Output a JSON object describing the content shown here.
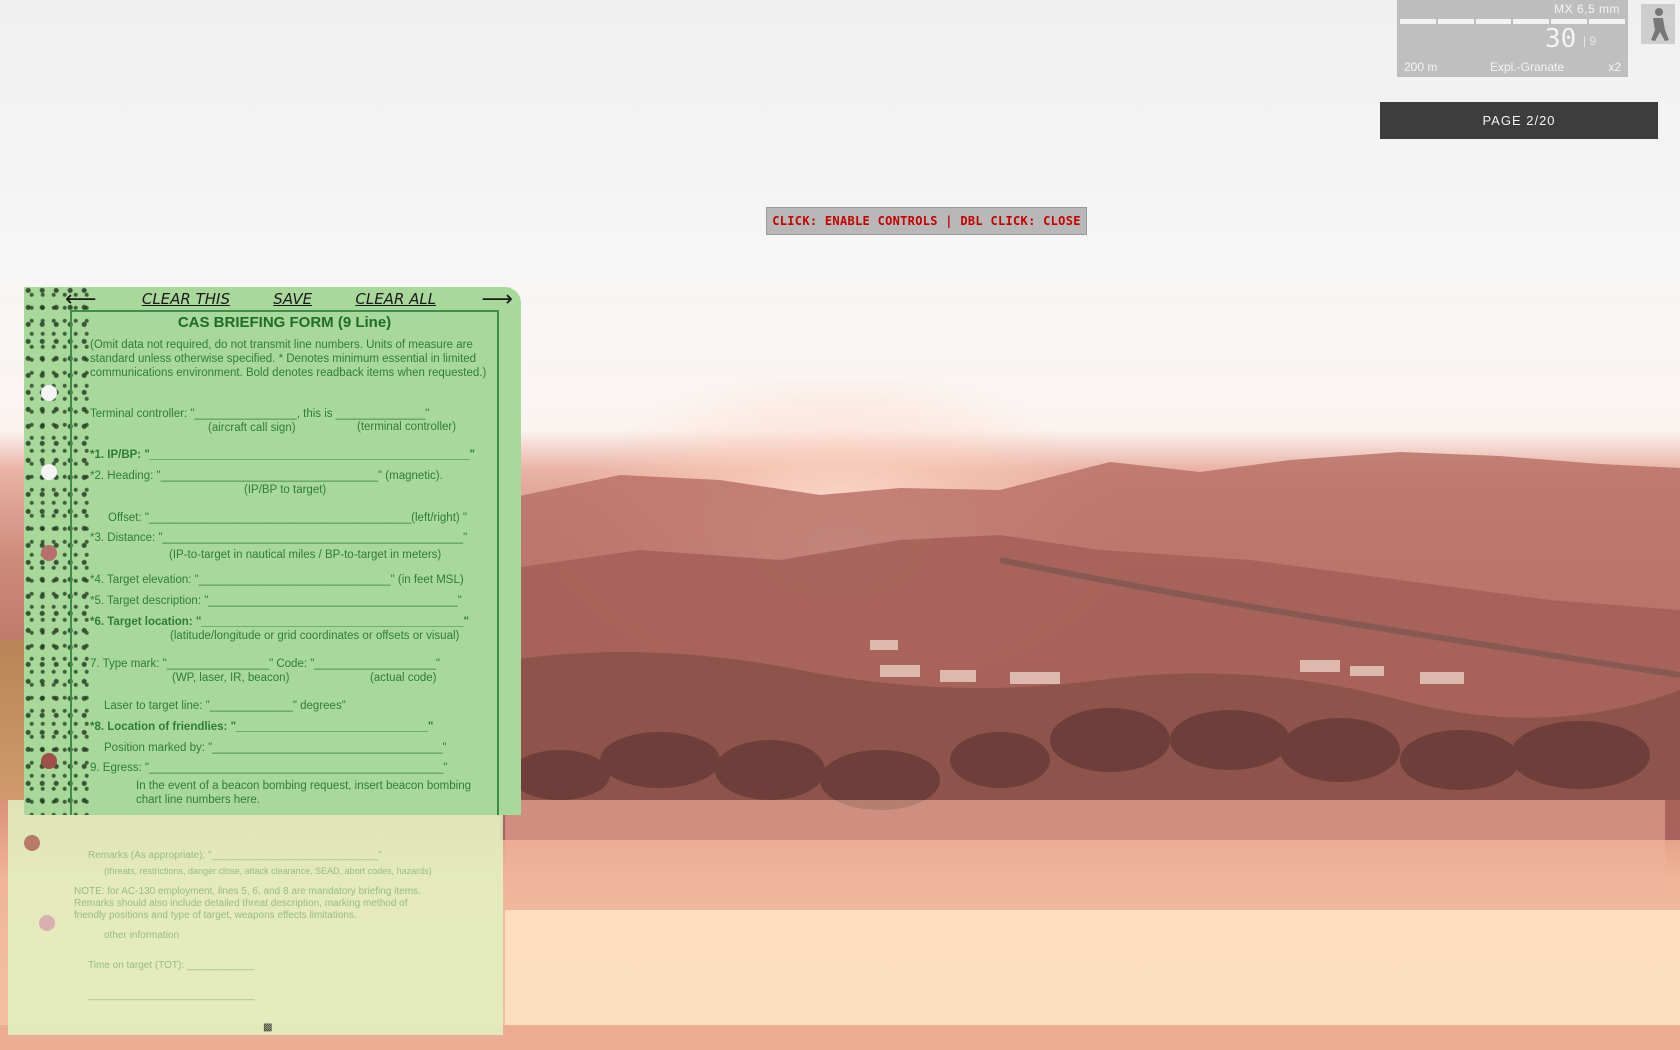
{
  "hud": {
    "weapon_name": "MX 6,5 mm",
    "ammo_count": "30",
    "magazines": "| 9",
    "zeroing": "200 m",
    "ammo_type": "Expl.-Granate",
    "multiplier": "x2"
  },
  "page_indicator": "PAGE 2/20",
  "hint": "CLICK: ENABLE CONTROLS | DBL CLICK: CLOSE",
  "form": {
    "toolbar": {
      "prev_arrow": "⟵",
      "clear_this": "CLEAR THIS",
      "save": "SAVE",
      "clear_all": "CLEAR ALL",
      "next_arrow": "⟶"
    },
    "title": "CAS BRIEFING FORM (9 Line)",
    "intro": "(Omit data not required, do not transmit line numbers. Units of measure are standard unless otherwise specified.  * Denotes minimum essential in limited communications environment.  Bold denotes readback items when requested.)",
    "terminal_controller": "Terminal controller: \"________________, this is ______________\"",
    "aircraft_call_sign": "(aircraft call sign)",
    "terminal_controller_sub": "(terminal controller)",
    "line1": "*1.   IP/BP: \"__________________________________________________\"",
    "line2": "*2.   Heading: \"__________________________________\" (magnetic).",
    "line2_sub": "(IP/BP to target)",
    "offset": "Offset: \"_________________________________________(left/right)  \"",
    "line3": "*3.  Distance: \"_______________________________________________\"",
    "line3_sub": "(IP-to-target in nautical miles / BP-to-target in meters)",
    "line4": "*4.  Target elevation: \"______________________________\" (in feet MSL)",
    "line5": "*5.  Target description: \"_______________________________________\"",
    "line6": "*6.  Target location: \"_________________________________________\"",
    "line6_sub": "(latitude/longitude or grid coordinates or offsets or visual)",
    "line7": "7.  Type mark: \"________________\" Code: \"___________________\"",
    "line7_sub_a": "(WP, laser, IR, beacon)",
    "line7_sub_b": "(actual code)",
    "laser": "Laser to target line: \"_____________\" degrees\"",
    "line8": "*8. Location of friendlies: \"______________________________\"",
    "position_marked": "Position marked by: \"____________________________________\"",
    "line9": "9.  Egress: \"______________________________________________\"",
    "beacon_note": "In the event of a beacon bombing request, insert beacon bombing",
    "beacon_note_2": "chart line numbers here.",
    "remarks": "Remarks (As appropriate): \"______________________________\"",
    "remarks_sub": "(threats, restrictions, danger close, attack clearance, SEAD, abort codes, hazards)",
    "note_1": "NOTE: for AC-130 employment, lines 5, 6, and 8 are mandatory briefing items.",
    "note_2": "Remarks should also include detailed threat description, marking method of",
    "note_3": "friendly positions and type of target, weapons effects limitations.",
    "note_4": "other information",
    "time_on_target": "Time on target (TOT): ____________",
    "bottom_line": "______________________________"
  }
}
